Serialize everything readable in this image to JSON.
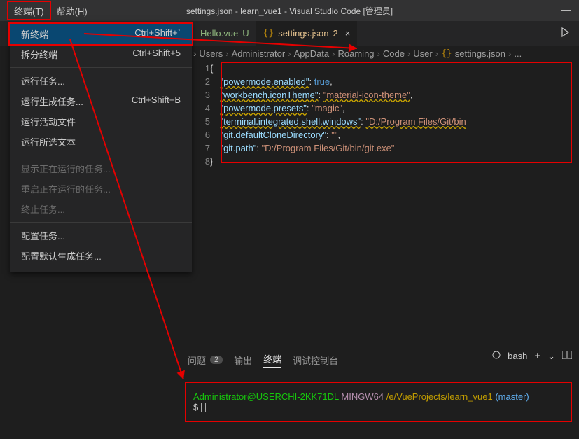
{
  "titlebar": {
    "menu_terminal": "终端(T)",
    "menu_help": "帮助(H)",
    "title": "settings.json - learn_vue1 - Visual Studio Code [管理员]",
    "minimize": "—"
  },
  "dropdown": {
    "new_terminal": "新终端",
    "new_terminal_kb": "Ctrl+Shift+`",
    "split": "拆分终端",
    "split_kb": "Ctrl+Shift+5",
    "run_task": "运行任务...",
    "run_build": "运行生成任务...",
    "run_build_kb": "Ctrl+Shift+B",
    "run_active": "运行活动文件",
    "run_selected": "运行所选文本",
    "show_running": "显示正在运行的任务...",
    "restart_running": "重启正在运行的任务...",
    "terminate": "终止任务...",
    "configure": "配置任务...",
    "configure_default": "配置默认生成任务..."
  },
  "tabs": {
    "hello": "Hello.vue",
    "hello_status": "U",
    "settings": "settings.json",
    "settings_badge": "2",
    "close": "×"
  },
  "crumbs": [
    "Users",
    "Administrator",
    "AppData",
    "Roaming",
    "Code",
    "User",
    "settings.json",
    "..."
  ],
  "editor": {
    "lines": [
      "1",
      "2",
      "3",
      "4",
      "5",
      "6",
      "7",
      "8"
    ],
    "k1": "\"powermode.enabled\"",
    "v1": "true",
    "k2": "\"workbench.iconTheme\"",
    "v2": "\"material-icon-theme\"",
    "k3": "\"powermode.presets\"",
    "v3": "\"magic\"",
    "k4": "\"terminal.integrated.shell.windows\"",
    "v4": "\"D:/Program Files/Git/bin",
    "k5": "\"git.defaultCloneDirectory\"",
    "v5": "\"\"",
    "k6": "\"git.path\"",
    "v6": "\"D:/Program Files/Git/bin/git.exe\""
  },
  "panel": {
    "problems": "问题",
    "problems_count": "2",
    "output": "输出",
    "terminal": "终端",
    "debug": "调试控制台",
    "shell": "bash",
    "plus": "+",
    "down": "⌄"
  },
  "terminal": {
    "user": "Administrator@USERCHI-2KK71DL",
    "sys": "MINGW64",
    "path": "/e/VueProjects/learn_vue1",
    "branch": "(master)",
    "prompt": "$"
  }
}
